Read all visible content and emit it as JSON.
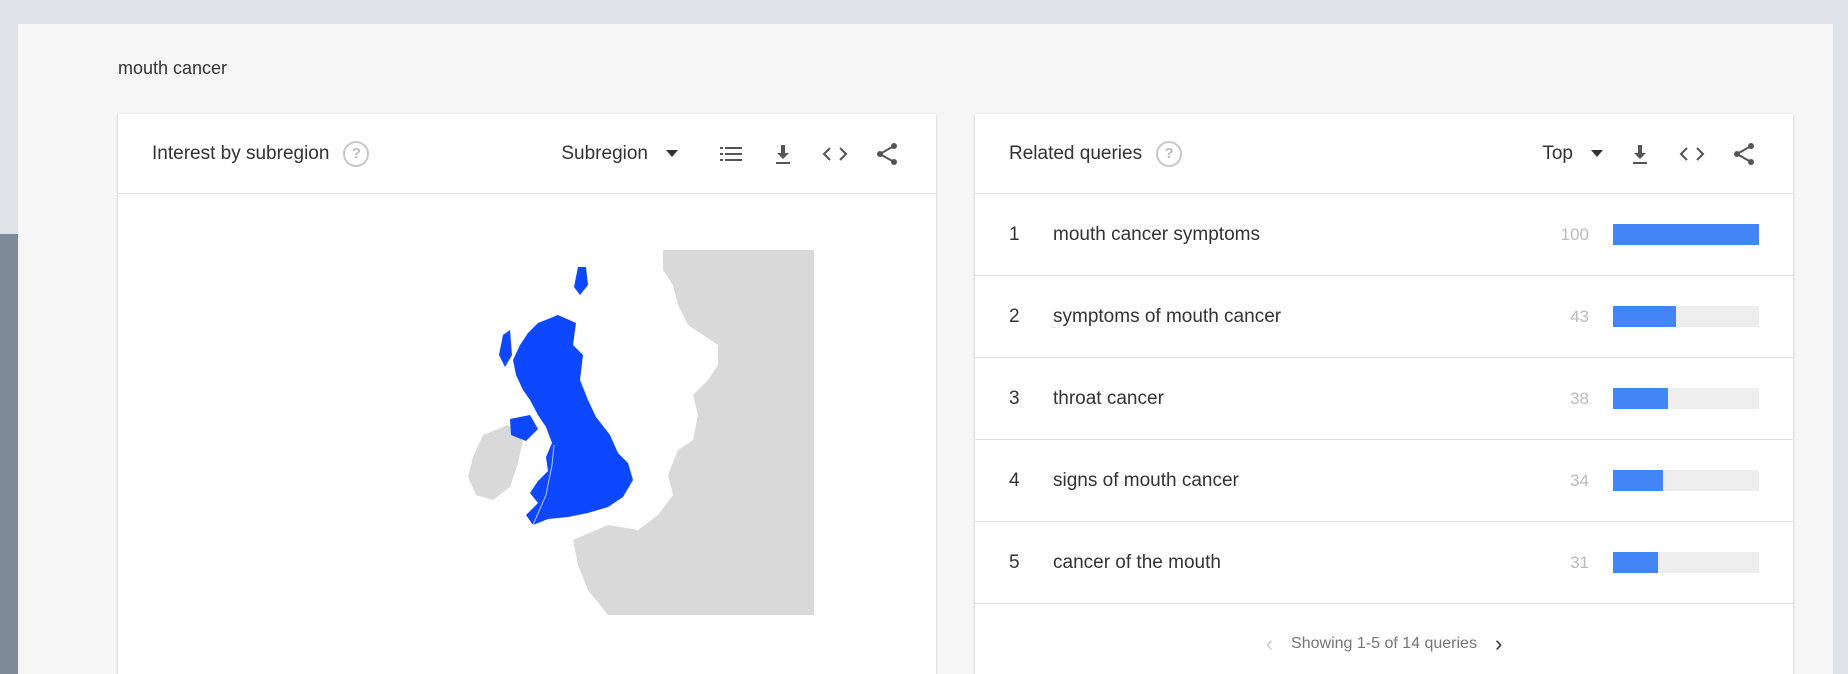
{
  "search_term": "mouth cancer",
  "interest_card": {
    "title": "Interest by subregion",
    "help_icon": "question-circle-icon",
    "dropdown_label": "Subregion",
    "icons": [
      "list-icon",
      "download-icon",
      "embed-code-icon",
      "share-icon"
    ],
    "map_highlight_color": "#0d47ff",
    "map_base_color": "#d9d9d9"
  },
  "related_card": {
    "title": "Related queries",
    "help_icon": "question-circle-icon",
    "dropdown_label": "Top",
    "icons": [
      "download-icon",
      "embed-code-icon",
      "share-icon"
    ],
    "queries": [
      {
        "rank": "1",
        "text": "mouth cancer symptoms",
        "value": "100",
        "pct": 100
      },
      {
        "rank": "2",
        "text": "symptoms of mouth cancer",
        "value": "43",
        "pct": 43
      },
      {
        "rank": "3",
        "text": "throat cancer",
        "value": "38",
        "pct": 38
      },
      {
        "rank": "4",
        "text": "signs of mouth cancer",
        "value": "34",
        "pct": 34
      },
      {
        "rank": "5",
        "text": "cancer of the mouth",
        "value": "31",
        "pct": 31
      }
    ],
    "pager_text": "Showing 1-5 of 14 queries",
    "bar_color": "#4285f4"
  }
}
